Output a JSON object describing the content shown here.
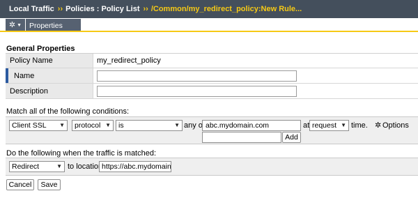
{
  "breadcrumb": {
    "items": [
      "Local Traffic",
      "Policies : Policy List",
      "/Common/my_redirect_policy:New Rule..."
    ],
    "separator": "››"
  },
  "toolbar": {
    "gear_icon": "gear-icon",
    "tab_label": "Properties"
  },
  "general": {
    "title": "General Properties",
    "policy_name_label": "Policy Name",
    "policy_name_value": "my_redirect_policy",
    "name_label": "Name",
    "name_value": "",
    "description_label": "Description",
    "description_value": ""
  },
  "conditions": {
    "title": "Match all of the following conditions:",
    "type_select": "Client SSL",
    "field_select": "protocol",
    "operator_select": "is",
    "any_of_label": "any of",
    "value_input": "abc.mydomain.com",
    "at_label": "at",
    "time_select": "request",
    "time_label": "time.",
    "options_label": "Options",
    "add_input": "",
    "add_button": "Add"
  },
  "actions": {
    "title": "Do the following when the traffic is matched:",
    "action_select": "Redirect",
    "to_location_label": "to location",
    "location_input": "https://abc.mydomain.com"
  },
  "buttons": {
    "cancel": "Cancel",
    "save": "Save"
  },
  "colors": {
    "header_bg": "#444f5c",
    "accent_yellow": "#f6c915",
    "tab_bg": "#566171",
    "required_marker": "#2c5aa0"
  }
}
